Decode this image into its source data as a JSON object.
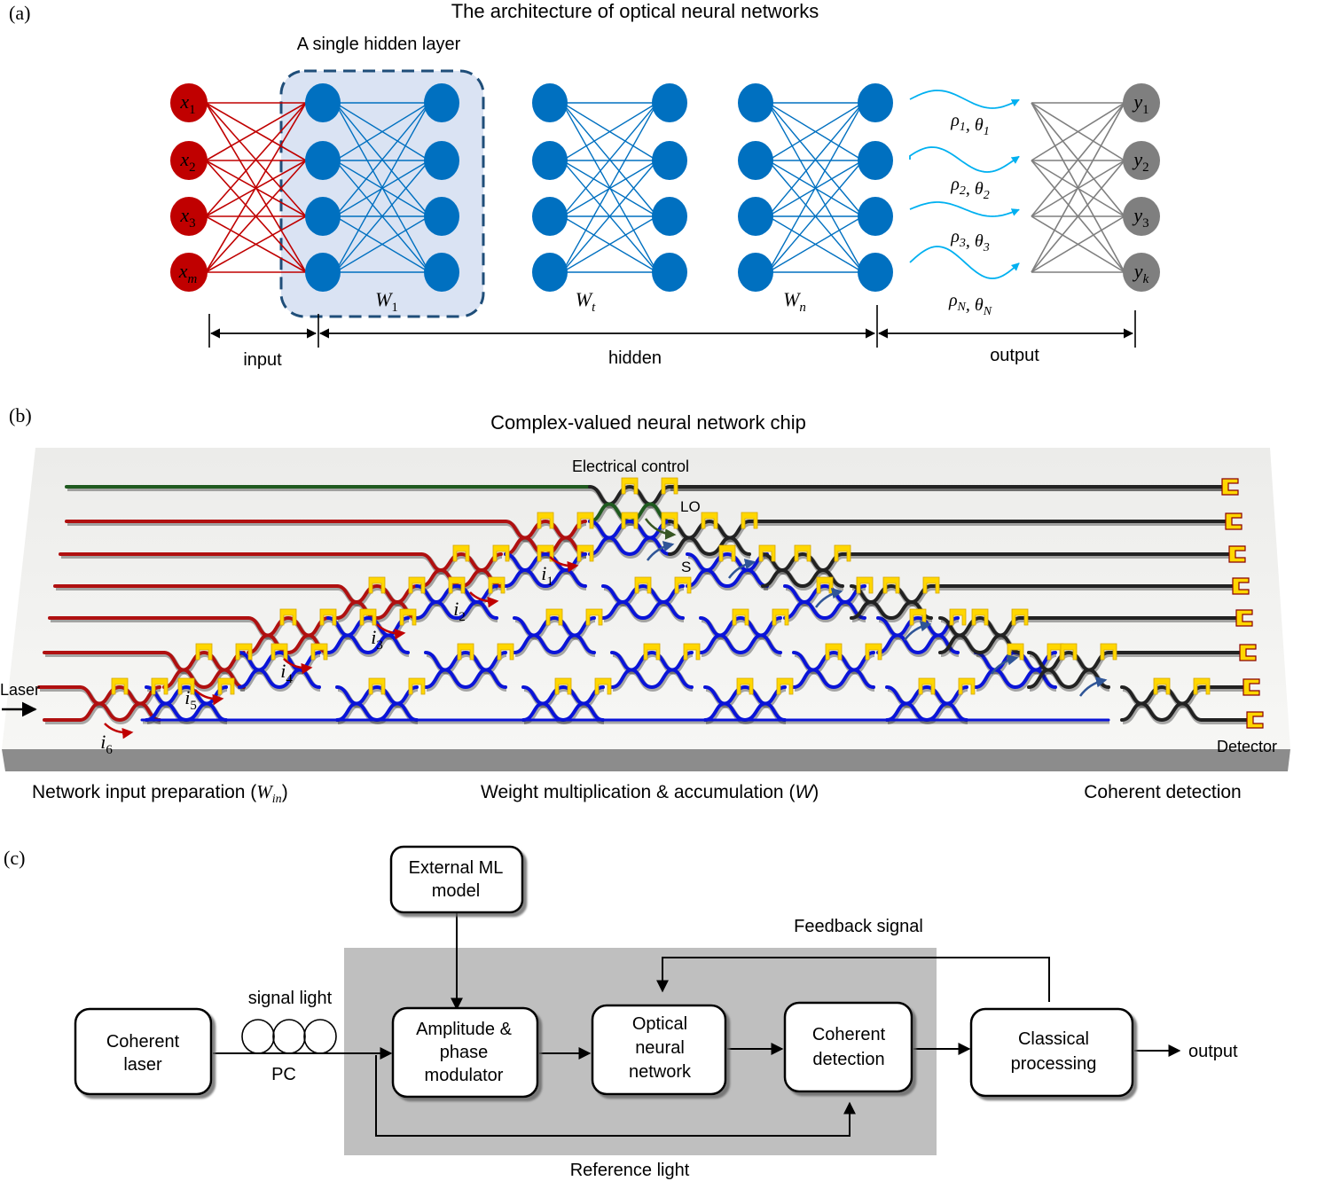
{
  "panel_a": {
    "label": "(a)",
    "title": "The architecture of optical neural networks",
    "hidden_box_label": "A single hidden layer",
    "inputs": [
      {
        "base": "x",
        "sub": "1"
      },
      {
        "base": "x",
        "sub": "2"
      },
      {
        "base": "x",
        "sub": "3"
      },
      {
        "base": "x",
        "sub": "m"
      }
    ],
    "weights": [
      {
        "base": "W",
        "sub": "1"
      },
      {
        "base": "W",
        "sub": "t"
      },
      {
        "base": "W",
        "sub": "n"
      }
    ],
    "signals": [
      {
        "rho": "ρ",
        "rho_sub": "1",
        "theta": "θ",
        "theta_sub": "1"
      },
      {
        "rho": "ρ",
        "rho_sub": "2",
        "theta": "θ",
        "theta_sub": "2"
      },
      {
        "rho": "ρ",
        "rho_sub": "3",
        "theta": "θ",
        "theta_sub": "3"
      },
      {
        "rho": "ρ",
        "rho_sub": "N",
        "theta": "θ",
        "theta_sub": "N"
      }
    ],
    "outputs": [
      {
        "base": "y",
        "sub": "1"
      },
      {
        "base": "y",
        "sub": "2"
      },
      {
        "base": "y",
        "sub": "3"
      },
      {
        "base": "y",
        "sub": "k"
      }
    ],
    "spans": {
      "input": "input",
      "hidden": "hidden",
      "output": "output"
    },
    "colors": {
      "input_node": "#c00000",
      "hidden_node": "#0070c0",
      "output_node": "#7f7f7f",
      "wave": "#00b0f0",
      "box_fill": "#dae3f3",
      "box_stroke": "#1f4e79"
    }
  },
  "panel_b": {
    "label": "(b)",
    "title": "Complex-valued neural network chip",
    "electrical_control": "Electrical control",
    "laser": "Laser",
    "lo": "LO",
    "s": "S",
    "detector": "Detector",
    "input_labels": [
      {
        "base": "i",
        "sub": "1"
      },
      {
        "base": "i",
        "sub": "2"
      },
      {
        "base": "i",
        "sub": "3"
      },
      {
        "base": "i",
        "sub": "4"
      },
      {
        "base": "i",
        "sub": "5"
      },
      {
        "base": "i",
        "sub": "6"
      }
    ],
    "section_left": {
      "text": "Network input preparation (",
      "sym": "W",
      "sub": "in",
      "end": ")"
    },
    "section_mid": {
      "text": "Weight multiplication & accumulation (",
      "sym": "W",
      "end": ")"
    },
    "section_right": "Coherent detection",
    "colors": {
      "input_wg": "#b01010",
      "weight_wg": "#0a14d8",
      "lo_wg": "#1f5a1f",
      "detect_wg": "#222222",
      "heater": "#ffd700",
      "chip": "#f2f2f0"
    }
  },
  "panel_c": {
    "label": "(c)",
    "blocks": {
      "laser": [
        "Coherent",
        "laser"
      ],
      "ml": [
        "External ML",
        "model"
      ],
      "modulator": [
        "Amplitude &",
        "phase",
        "modulator"
      ],
      "onn": [
        "Optical",
        "neural",
        "network"
      ],
      "detection": [
        "Coherent",
        "detection"
      ],
      "classical": [
        "Classical",
        "processing"
      ]
    },
    "signal_light": "signal light",
    "pc": "PC",
    "feedback": "Feedback signal",
    "reference": "Reference light",
    "output": "output",
    "colors": {
      "gray_box": "#bfbfbf"
    }
  }
}
